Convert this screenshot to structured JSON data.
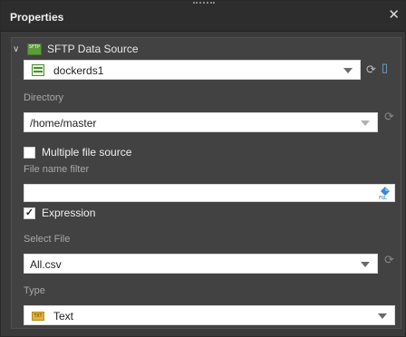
{
  "panel": {
    "title": "Properties"
  },
  "section": {
    "label": "SFTP Data Source",
    "icon": "sftp-icon"
  },
  "datasource": {
    "value": "dockerds1"
  },
  "directory": {
    "label": "Directory",
    "value": "/home/master"
  },
  "multi_file": {
    "label": "Multiple file source",
    "checked": false
  },
  "filter": {
    "label": "File name filter",
    "value": ""
  },
  "expression": {
    "label": "Expression",
    "checked": true
  },
  "select_file": {
    "label": "Select File",
    "value": "All.csv"
  },
  "type": {
    "label": "Type",
    "value": "Text"
  },
  "colors": {
    "header_bg": "#2d2d2d",
    "panel_bg": "#424242",
    "field_bg": "#ffffff",
    "accent_green": "#5e9b3a"
  }
}
